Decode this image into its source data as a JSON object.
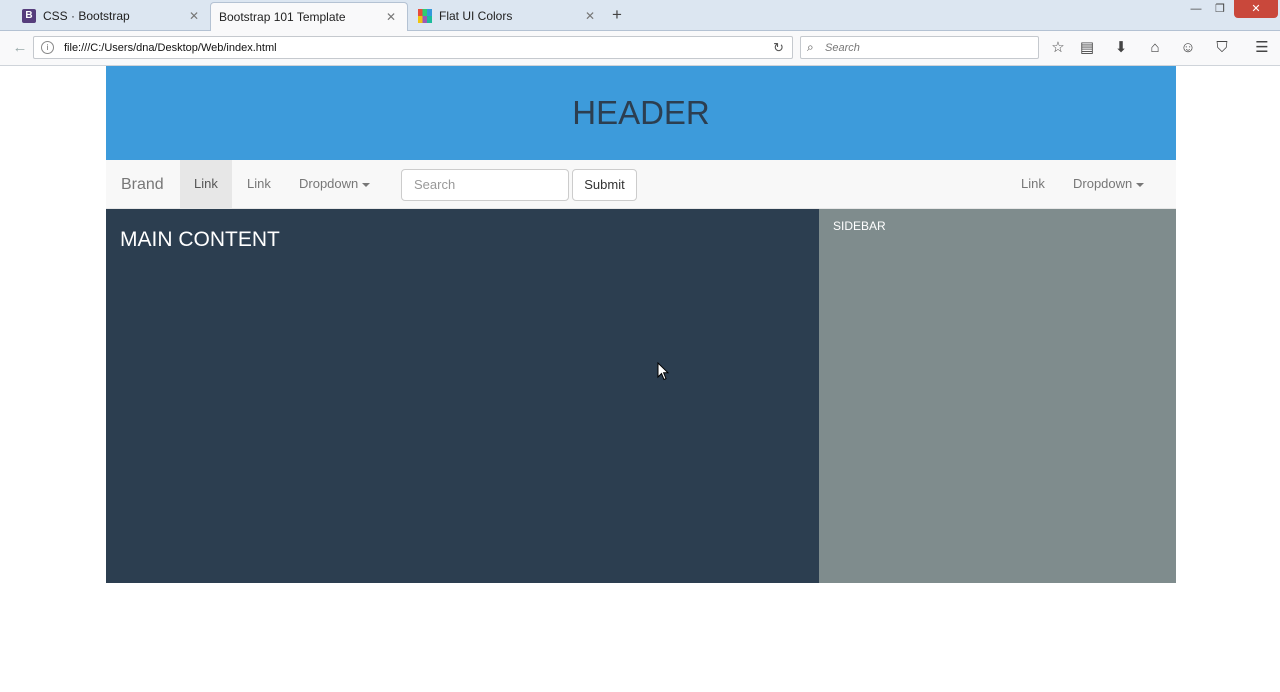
{
  "browser": {
    "tabs": [
      {
        "title": "CSS · Bootstrap",
        "favicon": "bootstrap-b-icon",
        "active": false
      },
      {
        "title": "Bootstrap 101 Template",
        "favicon": "",
        "active": true
      },
      {
        "title": "Flat UI Colors",
        "favicon": "flat-ui-grid-icon",
        "active": false
      }
    ],
    "new_tab_label": "+",
    "url": "file:///C:/Users/dna/Desktop/Web/index.html",
    "search_placeholder": "Search",
    "toolbar_icons": [
      "star-icon",
      "reading-list-icon",
      "download-icon",
      "home-icon",
      "chat-icon",
      "pocket-icon",
      "menu-icon"
    ]
  },
  "page": {
    "header": "HEADER",
    "navbar": {
      "brand": "Brand",
      "left_links": [
        "Link",
        "Link"
      ],
      "left_dropdown": "Dropdown",
      "search_placeholder": "Search",
      "submit_label": "Submit",
      "right_link": "Link",
      "right_dropdown": "Dropdown"
    },
    "main_content_label": "MAIN CONTENT",
    "sidebar_label": "SIDEBAR"
  },
  "colors": {
    "header_bg": "#3d9bdb",
    "main_bg": "#2c3e50",
    "sidebar_bg": "#7f8c8d",
    "navbar_bg": "#f8f8f8"
  }
}
